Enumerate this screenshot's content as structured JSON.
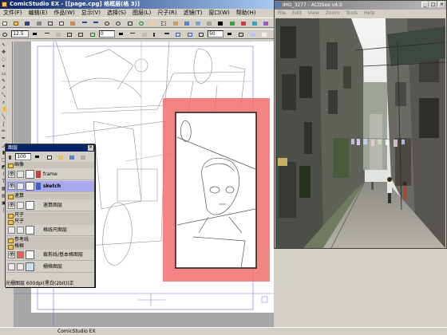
{
  "comicstudio": {
    "title": "ComicStudio EX - [[page.cpg] 格框层(格 3)]",
    "menu": [
      "文件(F)",
      "编辑(E)",
      "作品(W)",
      "显示(V)",
      "选择(S)",
      "图层(L)",
      "尺子(R)",
      "滤镜(T)",
      "窗口(W)",
      "帮助(H)"
    ],
    "toolbar2": {
      "zoom_value": "12.5",
      "rotate_value": "0",
      "opacity_value": "50"
    },
    "status_text": "ComicStudio EX"
  },
  "layer_palette": {
    "title": "图层",
    "close_glyph": "×",
    "opacity_value": "100",
    "folder_draft": "画像",
    "layers": [
      {
        "name": "frame",
        "visible": true
      },
      {
        "name": "sketch",
        "visible": true,
        "selected": true
      }
    ],
    "folder_speed": "速算",
    "speed_layer": "速算图层",
    "folder_ruler_a": "尺子",
    "folder_ruler_b": "尺子",
    "ruler_layer": "格线尺图层",
    "folder_guides": "参考线",
    "folder_frames": "格框",
    "frame_layer": "裁剪线/基本格图层",
    "grid_layer": "栅格图层",
    "footer": "光栅图层 600dpi(黑白(2bit))正"
  },
  "acdsee": {
    "title": "IMG_3277 - ACDSee v4.0",
    "menu": [
      "File",
      "Edit",
      "View",
      "Zoom",
      "Tools",
      "Help"
    ]
  },
  "colors": {
    "titlebar_active": "#0a246a",
    "selection": "#a8a8f0",
    "frame_highlight": "#f08080"
  }
}
